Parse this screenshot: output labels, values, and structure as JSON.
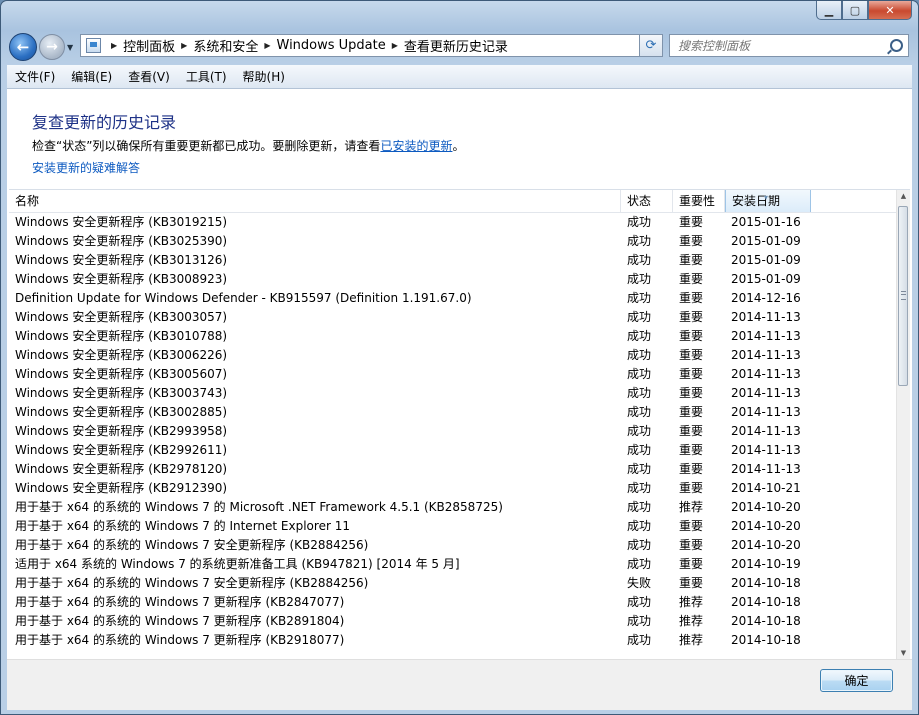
{
  "window": {
    "caption": {
      "minimize": "▁",
      "maximize": "▢",
      "close": "✕"
    }
  },
  "address": {
    "crumbs": [
      "控制面板",
      "系统和安全",
      "Windows Update",
      "查看更新历史记录"
    ]
  },
  "search": {
    "placeholder": "搜索控制面板"
  },
  "menu": [
    "文件(F)",
    "编辑(E)",
    "查看(V)",
    "工具(T)",
    "帮助(H)"
  ],
  "content": {
    "title": "复查更新的历史记录",
    "desc_prefix": "检查“状态”列以确保所有重要更新都已成功。要删除更新，请查看",
    "desc_link": "已安装的更新",
    "desc_suffix": "。",
    "troubleshoot_link": "安装更新的疑难解答"
  },
  "table": {
    "columns": [
      "名称",
      "状态",
      "重要性",
      "安装日期"
    ],
    "rows": [
      [
        "Windows 安全更新程序 (KB3019215)",
        "成功",
        "重要",
        "2015-01-16"
      ],
      [
        "Windows 安全更新程序 (KB3025390)",
        "成功",
        "重要",
        "2015-01-09"
      ],
      [
        "Windows 安全更新程序 (KB3013126)",
        "成功",
        "重要",
        "2015-01-09"
      ],
      [
        "Windows 安全更新程序 (KB3008923)",
        "成功",
        "重要",
        "2015-01-09"
      ],
      [
        "Definition Update for Windows Defender - KB915597 (Definition 1.191.67.0)",
        "成功",
        "重要",
        "2014-12-16"
      ],
      [
        "Windows 安全更新程序 (KB3003057)",
        "成功",
        "重要",
        "2014-11-13"
      ],
      [
        "Windows 安全更新程序 (KB3010788)",
        "成功",
        "重要",
        "2014-11-13"
      ],
      [
        "Windows 安全更新程序 (KB3006226)",
        "成功",
        "重要",
        "2014-11-13"
      ],
      [
        "Windows 安全更新程序 (KB3005607)",
        "成功",
        "重要",
        "2014-11-13"
      ],
      [
        "Windows 安全更新程序 (KB3003743)",
        "成功",
        "重要",
        "2014-11-13"
      ],
      [
        "Windows 安全更新程序 (KB3002885)",
        "成功",
        "重要",
        "2014-11-13"
      ],
      [
        "Windows 安全更新程序 (KB2993958)",
        "成功",
        "重要",
        "2014-11-13"
      ],
      [
        "Windows 安全更新程序 (KB2992611)",
        "成功",
        "重要",
        "2014-11-13"
      ],
      [
        "Windows 安全更新程序 (KB2978120)",
        "成功",
        "重要",
        "2014-11-13"
      ],
      [
        "Windows 安全更新程序 (KB2912390)",
        "成功",
        "重要",
        "2014-10-21"
      ],
      [
        "用于基于 x64 的系统的 Windows 7 的 Microsoft .NET Framework 4.5.1 (KB2858725)",
        "成功",
        "推荐",
        "2014-10-20"
      ],
      [
        "用于基于 x64 的系统的 Windows 7 的 Internet Explorer 11",
        "成功",
        "重要",
        "2014-10-20"
      ],
      [
        "用于基于 x64 的系统的 Windows 7 安全更新程序 (KB2884256)",
        "成功",
        "重要",
        "2014-10-20"
      ],
      [
        "适用于 x64 系统的 Windows 7 的系统更新准备工具 (KB947821) [2014 年 5 月]",
        "成功",
        "重要",
        "2014-10-19"
      ],
      [
        "用于基于 x64 的系统的 Windows 7 安全更新程序 (KB2884256)",
        "失败",
        "重要",
        "2014-10-18"
      ],
      [
        "用于基于 x64 的系统的 Windows 7 更新程序 (KB2847077)",
        "成功",
        "推荐",
        "2014-10-18"
      ],
      [
        "用于基于 x64 的系统的 Windows 7 更新程序 (KB2891804)",
        "成功",
        "推荐",
        "2014-10-18"
      ],
      [
        "用于基于 x64 的系统的 Windows 7 更新程序 (KB2918077)",
        "成功",
        "推荐",
        "2014-10-18"
      ]
    ]
  },
  "buttons": {
    "ok": "确定"
  }
}
